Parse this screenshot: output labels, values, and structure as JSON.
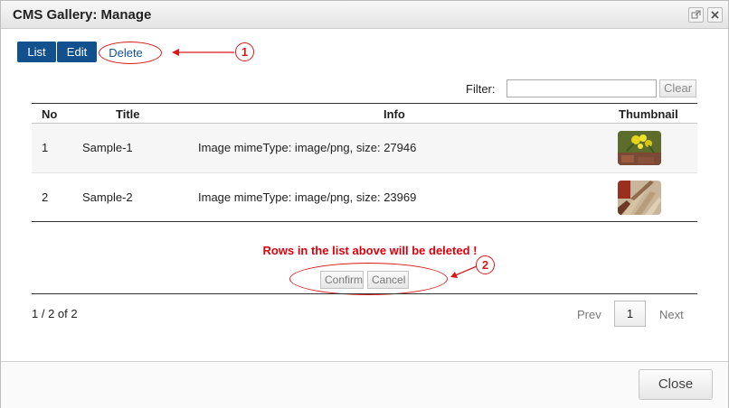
{
  "window": {
    "title": "CMS Gallery: Manage",
    "restore_icon": "popout-icon",
    "close_icon": "close-icon"
  },
  "tabs": [
    {
      "label": "List"
    },
    {
      "label": "Edit"
    },
    {
      "label": "Delete"
    }
  ],
  "annotations": {
    "marker_1": "1",
    "marker_2": "2",
    "color": "#d7191c"
  },
  "filter": {
    "label": "Filter:",
    "value": "",
    "clear_label": "Clear"
  },
  "table": {
    "headers": {
      "no": "No",
      "title": "Title",
      "info": "Info",
      "thumbnail": "Thumbnail"
    },
    "rows": [
      {
        "no": "1",
        "title": "Sample-1",
        "info": "Image mimeType: image/png, size: 27946",
        "thumbnail": "yellow-flowers-thumbnail"
      },
      {
        "no": "2",
        "title": "Sample-2",
        "info": "Image mimeType: image/png, size: 23969",
        "thumbnail": "wooden-fence-thumbnail"
      }
    ]
  },
  "delete_confirm": {
    "message": "Rows in the list above will be deleted !",
    "confirm_label": "Confirm",
    "cancel_label": "Cancel",
    "message_color": "#e0000b"
  },
  "pagination": {
    "summary": "1 / 2 of 2",
    "prev_label": "Prev",
    "current_page": "1",
    "next_label": "Next"
  },
  "footer": {
    "close_label": "Close"
  },
  "colors": {
    "tab_active": "#12508e"
  }
}
